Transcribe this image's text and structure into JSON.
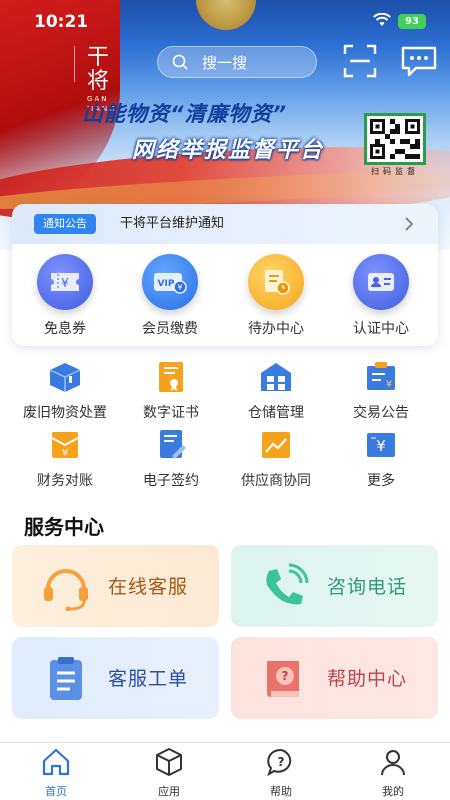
{
  "status": {
    "time": "10:21",
    "battery": "93"
  },
  "header": {
    "logo_text": "干将",
    "logo_pinyin": "GAN JIANG",
    "search_placeholder": "搜一搜"
  },
  "banner": {
    "line1": "山能物资“清廉物资”",
    "line2": "网络举报监督平台",
    "qr_caption": "扫码监督"
  },
  "notice": {
    "tag": "通知公告",
    "text": "干将平台维护通知"
  },
  "quick": [
    {
      "label": "免息券",
      "icon": "coupon-icon"
    },
    {
      "label": "会员缴费",
      "icon": "vip-card-icon"
    },
    {
      "label": "待办中心",
      "icon": "todo-clock-icon"
    },
    {
      "label": "认证中心",
      "icon": "id-card-icon"
    }
  ],
  "grid": [
    {
      "label": "废旧物资处置",
      "icon": "box-icon"
    },
    {
      "label": "数字证书",
      "icon": "certificate-icon"
    },
    {
      "label": "仓储管理",
      "icon": "warehouse-icon"
    },
    {
      "label": "交易公告",
      "icon": "announcement-icon"
    },
    {
      "label": "财务对账",
      "icon": "finance-icon"
    },
    {
      "label": "电子签约",
      "icon": "e-sign-icon"
    },
    {
      "label": "供应商协同",
      "icon": "chart-icon"
    },
    {
      "label": "更多",
      "icon": "more-icon"
    }
  ],
  "service": {
    "title": "服务中心",
    "items": [
      {
        "label": "在线客服",
        "icon": "headset-icon",
        "color": "#a55a14"
      },
      {
        "label": "咨询电话",
        "icon": "phone-icon",
        "color": "#2f9a7e"
      },
      {
        "label": "客服工单",
        "icon": "clipboard-icon",
        "color": "#2e4fa0"
      },
      {
        "label": "帮助中心",
        "icon": "help-book-icon",
        "color": "#c2414b"
      }
    ]
  },
  "tabs": [
    {
      "label": "首页",
      "icon": "home-icon",
      "active": true
    },
    {
      "label": "应用",
      "icon": "cube-icon",
      "active": false
    },
    {
      "label": "帮助",
      "icon": "help-icon",
      "active": false
    },
    {
      "label": "我的",
      "icon": "user-icon",
      "active": false
    }
  ],
  "colors": {
    "accent": "#2f6fe6",
    "tag": "#2f86f0"
  }
}
